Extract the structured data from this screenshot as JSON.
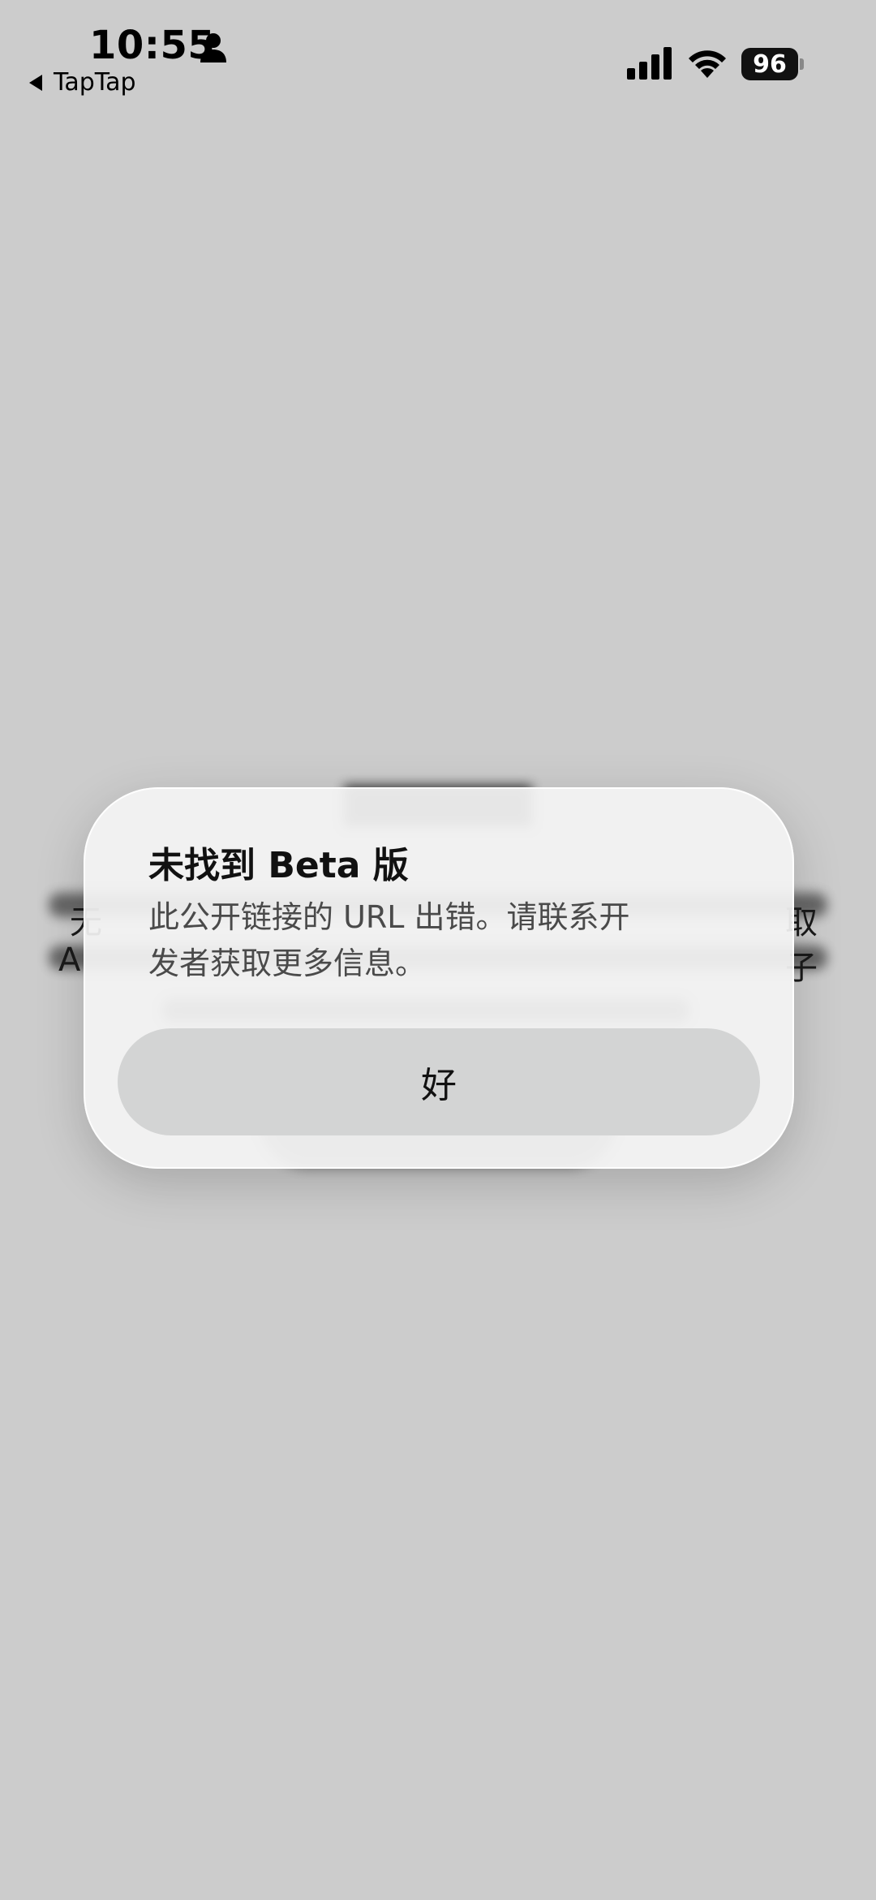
{
  "status_bar": {
    "time": "10:55",
    "back_app": "TapTap",
    "battery": "96",
    "icons": [
      "person-icon",
      "back-arrow-icon",
      "signal-icon",
      "wifi-icon",
      "battery-icon"
    ]
  },
  "alert": {
    "title": "未找到 Beta 版",
    "message": "此公开链接的 URL 出错。请联系开发者获取更多信息。",
    "ok_label": "好"
  },
  "background": {
    "edge_left_line1": "无",
    "edge_left_line2": "A",
    "edge_right_line1": "取",
    "edge_right_line2": "子"
  }
}
